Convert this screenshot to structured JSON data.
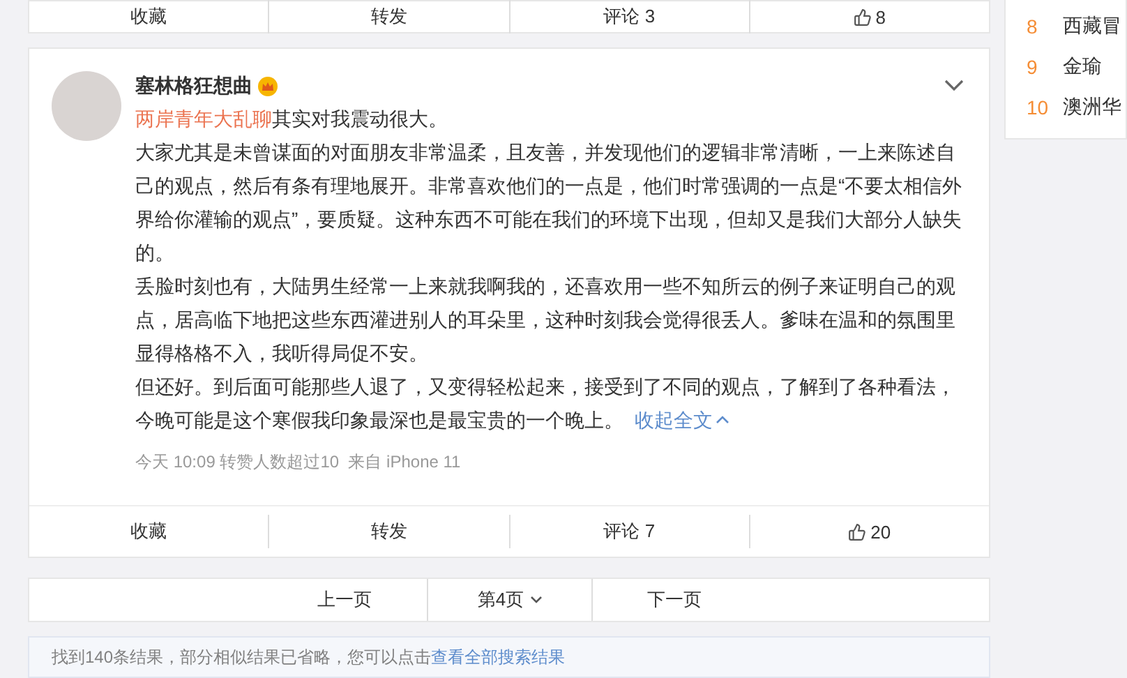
{
  "previous_post": {
    "actions": [
      {
        "kind": "text",
        "label": "收藏"
      },
      {
        "kind": "text",
        "label": "转发"
      },
      {
        "kind": "text",
        "label": "评论 3"
      },
      {
        "kind": "like",
        "label": "8"
      }
    ]
  },
  "post": {
    "author": "塞林格狂想曲",
    "topic_link": "两岸青年大乱聊",
    "topic_tail": "其实对我震动很大。",
    "paragraphs": [
      "大家尤其是未曾谋面的对面朋友非常温柔，且友善，并发现他们的逻辑非常清晰，一上来陈述自己的观点，然后有条有理地展开。非常喜欢他们的一点是，他们时常强调的一点是“不要太相信外界给你灌输的观点”，要质疑。这种东西不可能在我们的环境下出现，但却又是我们大部分人缺失的。",
      "丢脸时刻也有，大陆男生经常一上来就我啊我的，还喜欢用一些不知所云的例子来证明自己的观点，居高临下地把这些东西灌进别人的耳朵里，这种时刻我会觉得很丢人。爹味在温和的氛围里显得格格不入，我听得局促不安。",
      "但还好。到后面可能那些人退了，又变得轻松起来，接受到了不同的观点，了解到了各种看法，今晚可能是这个寒假我印象最深也是最宝贵的一个晚上。"
    ],
    "collapse_link": "收起全文",
    "meta": "今天 10:09 转赞人数超过10  来自 iPhone 11",
    "actions": [
      {
        "kind": "text",
        "label": "收藏"
      },
      {
        "kind": "text",
        "label": "转发"
      },
      {
        "kind": "text",
        "label": "评论 7"
      },
      {
        "kind": "like",
        "label": "20"
      }
    ]
  },
  "pagination": {
    "prev": "上一页",
    "current": "第4页",
    "next": "下一页"
  },
  "result_note": {
    "text": "找到140条结果，部分相似结果已省略，您可以点击",
    "link": "查看全部搜索结果"
  },
  "hot_list": [
    {
      "rank": "8",
      "title": "西藏冒"
    },
    {
      "rank": "9",
      "title": "金瑜"
    },
    {
      "rank": "10",
      "title": "澳洲华"
    }
  ]
}
